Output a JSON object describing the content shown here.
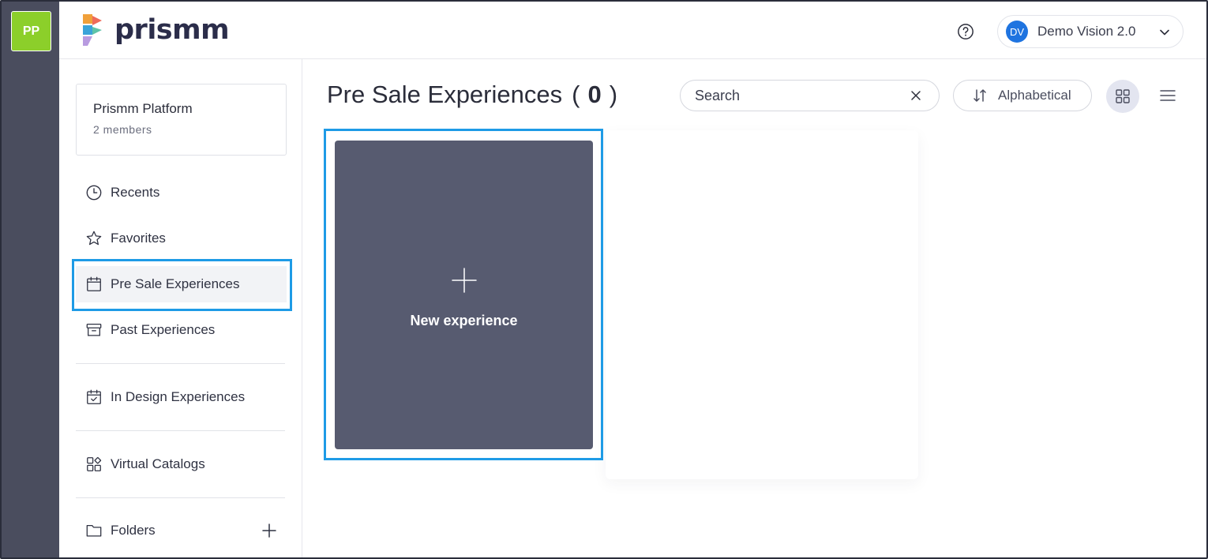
{
  "workspace": {
    "initials": "PP",
    "color": "#8ccf2a"
  },
  "brand": {
    "name": "prismm"
  },
  "account": {
    "initials": "DV",
    "name": "Demo Vision 2.0"
  },
  "team": {
    "name": "Prismm Platform",
    "members": "2 members"
  },
  "sidebar": {
    "items": [
      {
        "label": "Recents",
        "icon": "clock-icon"
      },
      {
        "label": "Favorites",
        "icon": "star-icon"
      },
      {
        "label": "Pre Sale Experiences",
        "icon": "calendar-icon",
        "active": true
      },
      {
        "label": "Past Experiences",
        "icon": "archive-icon"
      },
      {
        "label": "In Design Experiences",
        "icon": "calendar-check-icon"
      },
      {
        "label": "Virtual Catalogs",
        "icon": "shapes-icon"
      },
      {
        "label": "Folders",
        "icon": "folder-icon"
      }
    ]
  },
  "main": {
    "title": "Pre Sale Experiences",
    "count_open": "(",
    "count": "0",
    "count_close": ")",
    "search": {
      "placeholder": "Search",
      "value": ""
    },
    "sort_label": "Alphabetical",
    "view_mode": "grid",
    "new_card_label": "New experience"
  },
  "colors": {
    "accent_highlight": "#1e9be6",
    "rail": "#4a4d5e",
    "card": "#575b70",
    "avatar": "#1f74e0"
  }
}
